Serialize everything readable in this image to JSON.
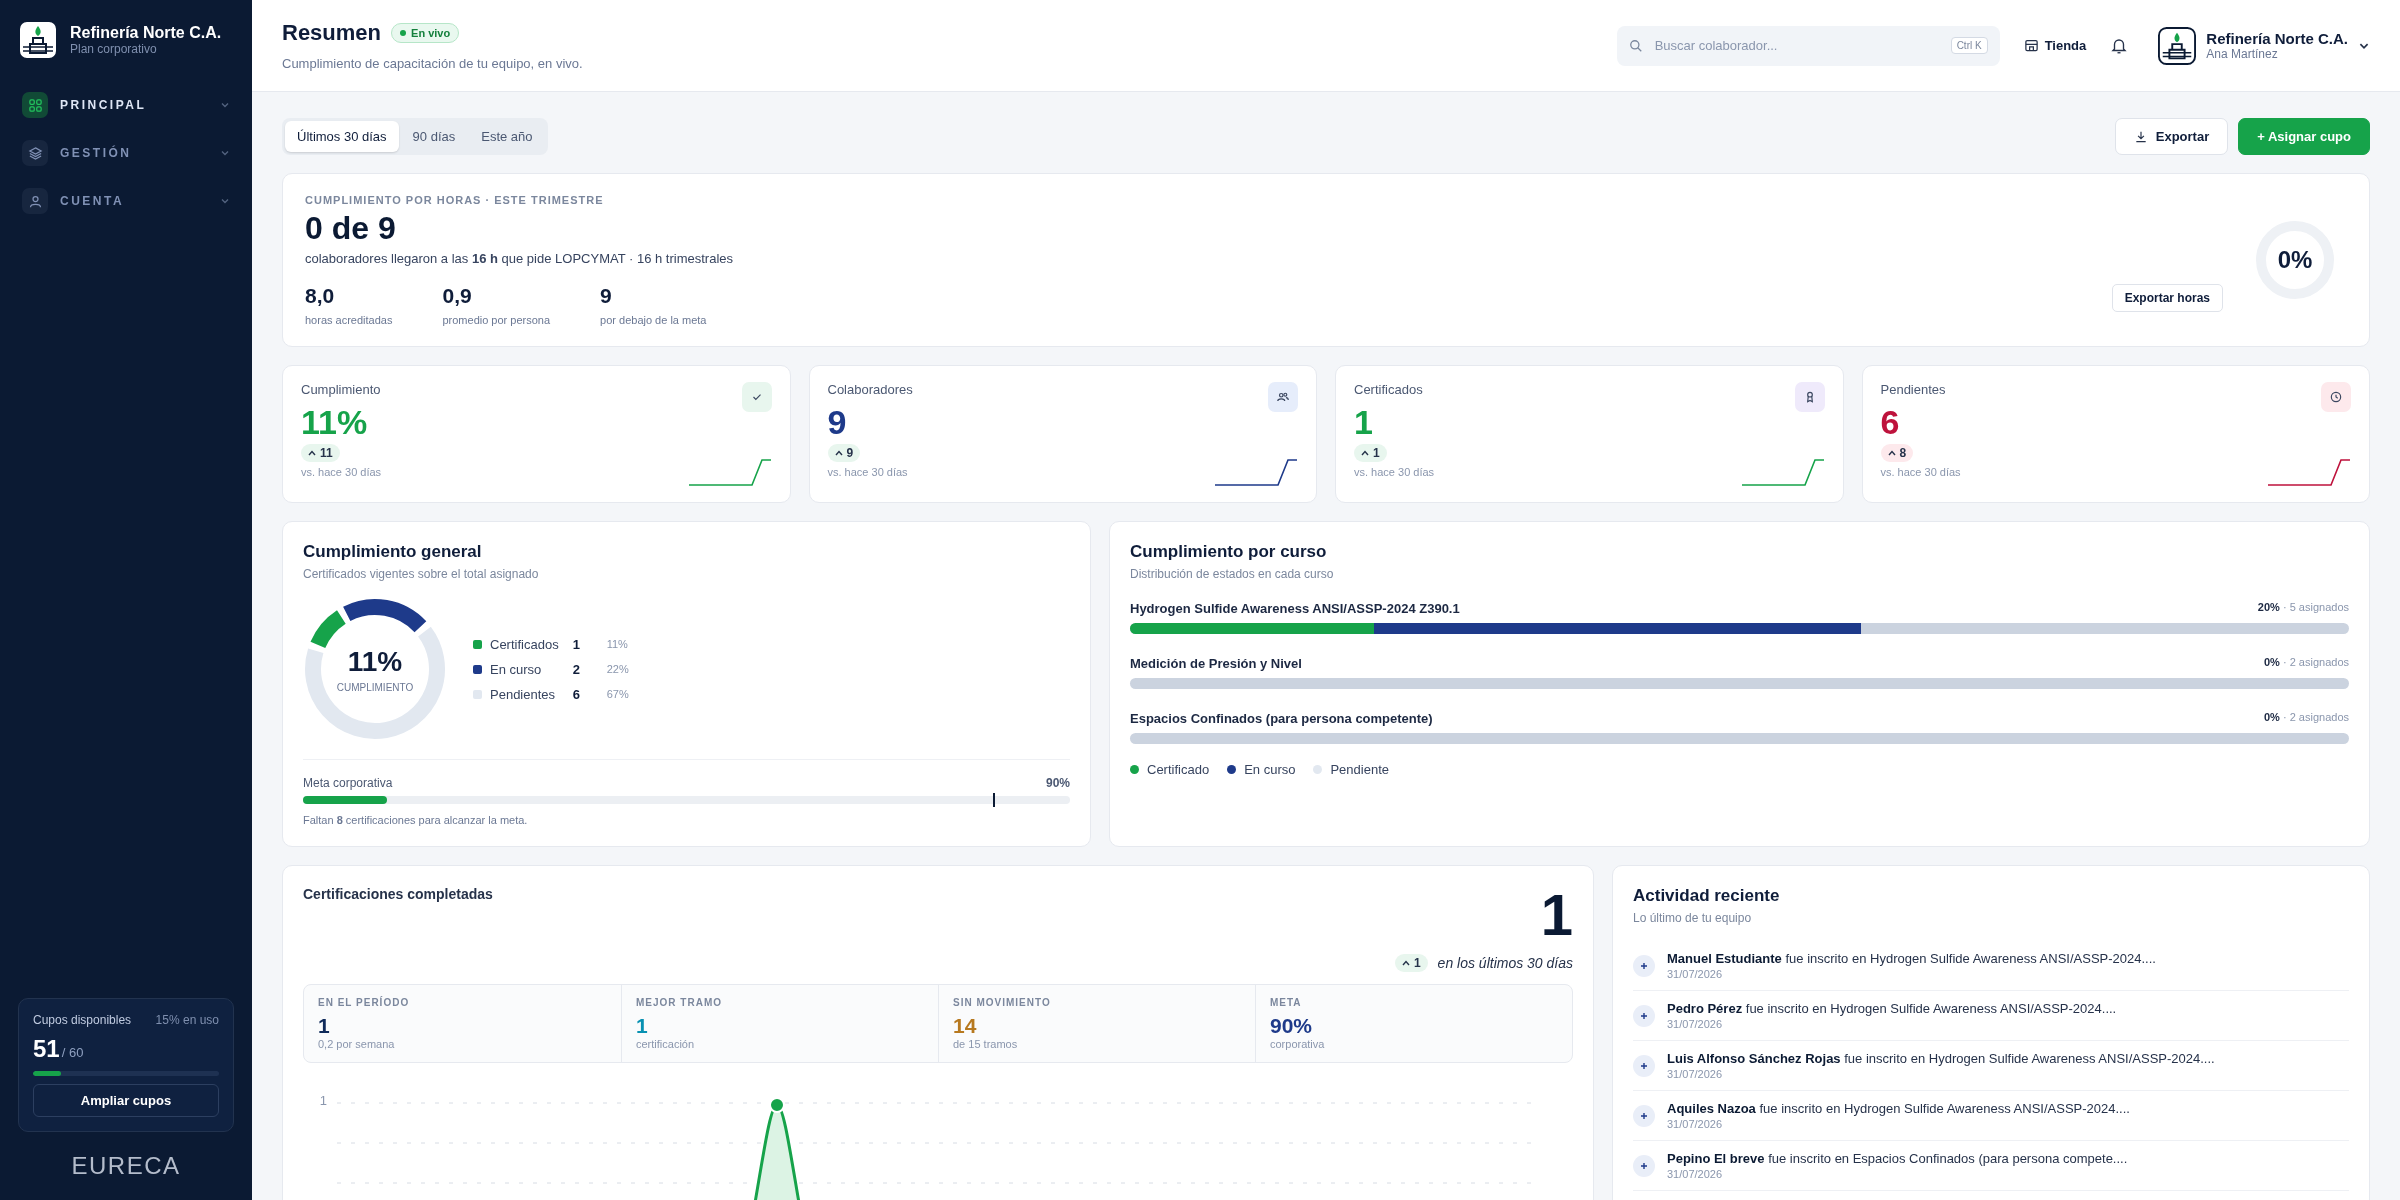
{
  "sidebar": {
    "brand": {
      "name": "Refinería Norte C.A.",
      "plan": "Plan corporativo"
    },
    "groups": [
      {
        "label": "PRINCIPAL",
        "selected": true
      },
      {
        "label": "GESTIÓN",
        "selected": false
      },
      {
        "label": "CUENTA",
        "selected": false
      }
    ],
    "quota": {
      "title": "Cupos disponibles",
      "usage": "15% en uso",
      "available": "51",
      "total": "/ 60",
      "level": 0.15,
      "button": "Ampliar cupos"
    },
    "footer_logo": "EURECA"
  },
  "header": {
    "title": "Resumen",
    "badge": "En vivo",
    "subtitle": "Cumplimiento de capacitación de tu equipo, en vivo.",
    "search": {
      "placeholder": "Buscar colaborador...",
      "shortcut": "Ctrl K"
    },
    "store": "Tienda",
    "user": {
      "org": "Refinería Norte C.A.",
      "name": "Ana Martínez"
    }
  },
  "period_tabs": [
    {
      "label": "Últimos 30 días",
      "selected": true
    },
    {
      "label": "90 días",
      "selected": false
    },
    {
      "label": "Este año",
      "selected": false
    }
  ],
  "actions": {
    "export": "Exportar",
    "assign": "+ Asignar cupo"
  },
  "hours": {
    "eyebrow": "CUMPLIMIENTO POR HORAS · ESTE TRIMESTRE",
    "headline": "0 de 9",
    "description": "colaboradores llegaron a las **16 h** que pide LOPCYMAT · 16 h trimestrales",
    "stats": [
      {
        "value": "8,0",
        "label": "horas acreditadas"
      },
      {
        "value": "0,9",
        "label": "promedio por persona"
      },
      {
        "value": "9",
        "label": "por debajo de la meta"
      }
    ],
    "ring": {
      "value": "0%"
    },
    "button": "Exportar horas"
  },
  "stat_cards": [
    {
      "title": "Cumplimiento",
      "value": "11%",
      "delta": "11",
      "caption": "vs. hace 30 días",
      "color": "#16a34a"
    },
    {
      "title": "Colaboradores",
      "value": "9",
      "delta": "9",
      "caption": "vs. hace 30 días",
      "color": "#1e3a8a"
    },
    {
      "title": "Certificados",
      "value": "1",
      "delta": "1",
      "caption": "vs. hace 30 días",
      "color": "#16a34a"
    },
    {
      "title": "Pendientes",
      "value": "6",
      "delta": "8",
      "caption": "vs. hace 30 días",
      "color": "#be123c"
    }
  ],
  "general": {
    "title": "Cumplimiento general",
    "subtitle": "Certificados vigentes sobre el total asignado",
    "donut": {
      "value": "11%",
      "label": "CUMPLIMIENTO"
    },
    "legend": [
      {
        "label": "Certificados",
        "count": "1",
        "pct": "11%",
        "color": "#16a34a"
      },
      {
        "label": "En curso",
        "count": "2",
        "pct": "22%",
        "color": "#1e3a8a"
      },
      {
        "label": "Pendientes",
        "count": "6",
        "pct": "67%",
        "color": "#e2e8f0"
      }
    ],
    "goal": {
      "label": "Meta corporativa",
      "value": "90%",
      "bar": {
        "level": 0.11
      },
      "marker": {
        "level": 0.9
      },
      "note": "Faltan **8** certificaciones para alcanzar la meta."
    }
  },
  "courses": {
    "title": "Cumplimiento por curso",
    "subtitle": "Distribución de estados en cada curso",
    "items": [
      {
        "name": "Hydrogen Sulfide Awareness ANSI/ASSP-2024 Z390.1",
        "pct": "20%",
        "assigned": "· 5 asignados",
        "segments": [
          {
            "level": 0.2
          },
          {
            "level": 0.4
          }
        ]
      },
      {
        "name": "Medición de Presión y Nivel",
        "pct": "0%",
        "assigned": "· 2 asignados"
      },
      {
        "name": "Espacios Confinados (para persona competente)",
        "pct": "0%",
        "assigned": "· 2 asignados"
      }
    ],
    "legend": [
      {
        "label": "Certificado",
        "color": "#16a34a"
      },
      {
        "label": "En curso",
        "color": "#1e3a8a"
      },
      {
        "label": "Pendiente",
        "color": "#e2e8f0"
      }
    ]
  },
  "completions": {
    "title": "Certificaciones completadas",
    "total": "1",
    "delta": "1",
    "delta_caption": "en los últimos 30 días",
    "stats": [
      {
        "label": "EN EL PERÍODO",
        "value": "1",
        "caption": "0,2 por semana",
        "color": "#0f2a5a"
      },
      {
        "label": "MEJOR TRAMO",
        "value": "1",
        "caption": "certificación",
        "color": "#0891b2"
      },
      {
        "label": "SIN MOVIMIENTO",
        "value": "14",
        "caption": "de 15 tramos",
        "color": "#b7791f"
      },
      {
        "label": "META",
        "value": "90%",
        "caption": "corporativa",
        "color": "#1e3a8a"
      }
    ],
    "chart": {
      "y_tick": "1"
    }
  },
  "activity": {
    "title": "Actividad reciente",
    "subtitle": "Lo último de tu equipo",
    "items": [
      {
        "text": "**Manuel Estudiante** fue inscrito en Hydrogen Sulfide Awareness ANSI/ASSP-2024....",
        "date": "31/07/2026"
      },
      {
        "text": "**Pedro Pérez** fue inscrito en Hydrogen Sulfide Awareness ANSI/ASSP-2024....",
        "date": "31/07/2026"
      },
      {
        "text": "**Luis Alfonso Sánchez Rojas** fue inscrito en Hydrogen Sulfide Awareness ANSI/ASSP-2024....",
        "date": "31/07/2026"
      },
      {
        "text": "**Aquiles Nazoa** fue inscrito en Hydrogen Sulfide Awareness ANSI/ASSP-2024....",
        "date": "31/07/2026"
      },
      {
        "text": "**Pepino El breve** fue inscrito en Espacios Confinados (para persona compete....",
        "date": "31/07/2026"
      }
    ]
  }
}
